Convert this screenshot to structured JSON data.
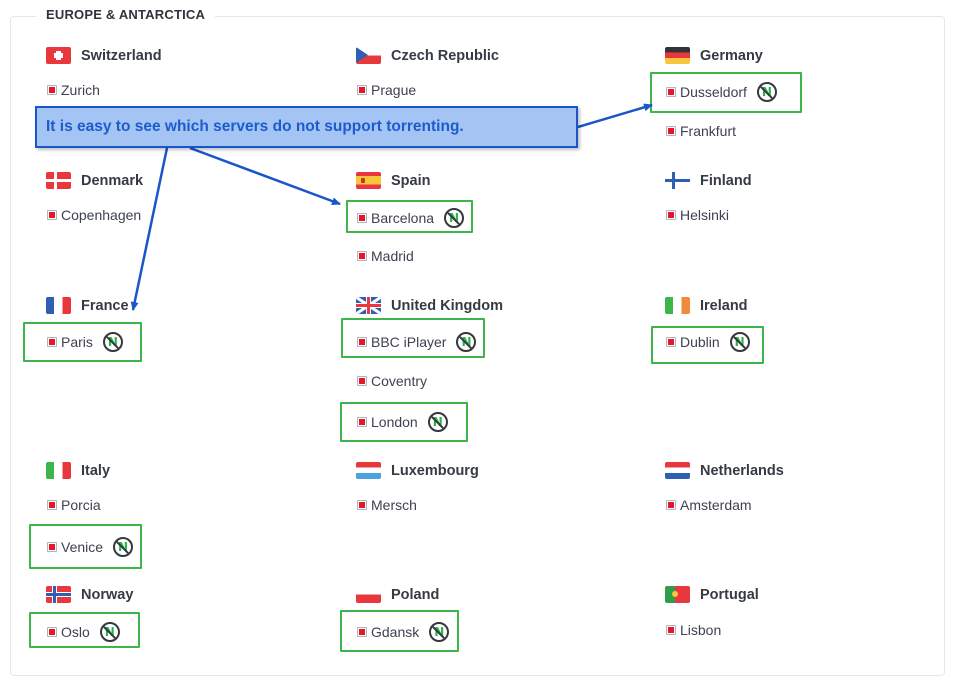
{
  "section_title": "EUROPE & ANTARCTICA",
  "callout_text": "It is easy to see which servers do not support torrenting.",
  "no_torrent_icon": "no-torrent-icon",
  "colors": {
    "highlight": "#3cb54a",
    "callout_border": "#1a56c9",
    "callout_fill": "#a4c4f4",
    "callout_text": "#1d5ccc",
    "server_bullet": "#e8162b"
  },
  "countries": [
    {
      "name": "Switzerland",
      "flag": "switzerland-flag",
      "servers": [
        {
          "name": "Zurich",
          "no_torrent": false
        }
      ]
    },
    {
      "name": "Czech Republic",
      "flag": "czech-flag",
      "servers": [
        {
          "name": "Prague",
          "no_torrent": false
        }
      ]
    },
    {
      "name": "Germany",
      "flag": "germany-flag",
      "servers": [
        {
          "name": "Dusseldorf",
          "no_torrent": true
        },
        {
          "name": "Frankfurt",
          "no_torrent": false
        }
      ]
    },
    {
      "name": "Denmark",
      "flag": "denmark-flag",
      "servers": [
        {
          "name": "Copenhagen",
          "no_torrent": false
        }
      ]
    },
    {
      "name": "Spain",
      "flag": "spain-flag",
      "servers": [
        {
          "name": "Barcelona",
          "no_torrent": true
        },
        {
          "name": "Madrid",
          "no_torrent": false
        }
      ]
    },
    {
      "name": "Finland",
      "flag": "finland-flag",
      "servers": [
        {
          "name": "Helsinki",
          "no_torrent": false
        }
      ]
    },
    {
      "name": "France",
      "flag": "france-flag",
      "servers": [
        {
          "name": "Paris",
          "no_torrent": true
        }
      ]
    },
    {
      "name": "United Kingdom",
      "flag": "uk-flag",
      "servers": [
        {
          "name": "BBC iPlayer",
          "no_torrent": true
        },
        {
          "name": "Coventry",
          "no_torrent": false
        },
        {
          "name": "London",
          "no_torrent": true
        }
      ]
    },
    {
      "name": "Ireland",
      "flag": "ireland-flag",
      "servers": [
        {
          "name": "Dublin",
          "no_torrent": true
        }
      ]
    },
    {
      "name": "Italy",
      "flag": "italy-flag",
      "servers": [
        {
          "name": "Porcia",
          "no_torrent": false
        },
        {
          "name": "Venice",
          "no_torrent": true
        }
      ]
    },
    {
      "name": "Luxembourg",
      "flag": "luxembourg-flag",
      "servers": [
        {
          "name": "Mersch",
          "no_torrent": false
        }
      ]
    },
    {
      "name": "Netherlands",
      "flag": "netherlands-flag",
      "servers": [
        {
          "name": "Amsterdam",
          "no_torrent": false
        }
      ]
    },
    {
      "name": "Norway",
      "flag": "norway-flag",
      "servers": [
        {
          "name": "Oslo",
          "no_torrent": true
        }
      ]
    },
    {
      "name": "Poland",
      "flag": "poland-flag",
      "servers": [
        {
          "name": "Gdansk",
          "no_torrent": true
        }
      ]
    },
    {
      "name": "Portugal",
      "flag": "portugal-flag",
      "servers": [
        {
          "name": "Lisbon",
          "no_torrent": false
        }
      ]
    }
  ]
}
